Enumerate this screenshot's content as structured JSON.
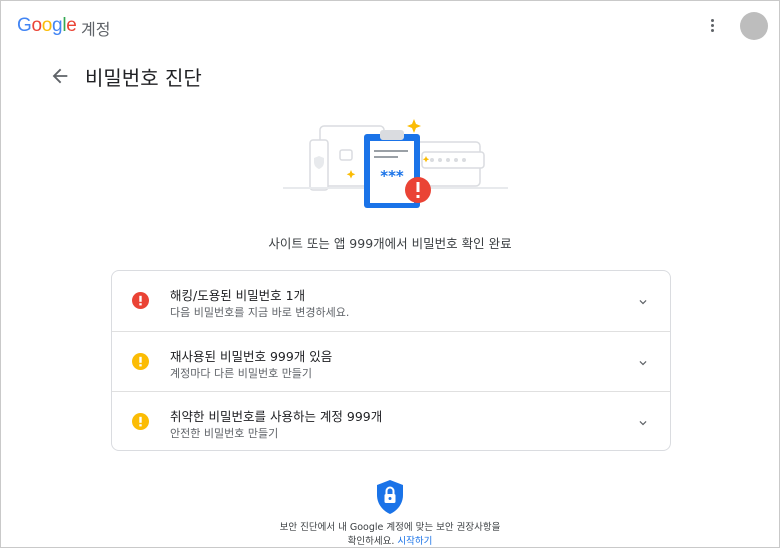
{
  "header": {
    "logo_letters": [
      {
        "ch": "G",
        "color": "#4285F4"
      },
      {
        "ch": "o",
        "color": "#EA4335"
      },
      {
        "ch": "o",
        "color": "#FBBC05"
      },
      {
        "ch": "g",
        "color": "#4285F4"
      },
      {
        "ch": "l",
        "color": "#34A853"
      },
      {
        "ch": "e",
        "color": "#EA4335"
      }
    ],
    "logo_suffix": "계정"
  },
  "page": {
    "title": "비밀번호 진단"
  },
  "summary": "사이트 또는 앱 999개에서 비밀번호 확인 완료",
  "issues": [
    {
      "title": "해킹/도용된 비밀번호 1개",
      "subtitle": "다음 비밀번호를 지금 바로 변경하세요.",
      "severity": "critical",
      "color": "#EA4335"
    },
    {
      "title": "재사용된 비밀번호 999개 있음",
      "subtitle": "계정마다 다른 비밀번호 만들기",
      "severity": "warning",
      "color": "#FBBC04"
    },
    {
      "title": "취약한 비밀번호를 사용하는 계정 999개",
      "subtitle": "안전한 비밀번호 만들기",
      "severity": "warning",
      "color": "#FBBC04"
    }
  ],
  "footer": {
    "line1": "보안 진단에서 내 Google 계정에 맞는 보안 권장사항을",
    "line2": "확인하세요.",
    "link": "시작하기"
  },
  "colors": {
    "accent": "#1a73e8",
    "shield": "#1a73e8"
  },
  "icons": {
    "menu": "more-vert-icon",
    "back": "arrow-back-icon",
    "expand": "chevron-down-icon",
    "status": "exclamation-icon",
    "footer": "lock-shield-icon"
  }
}
